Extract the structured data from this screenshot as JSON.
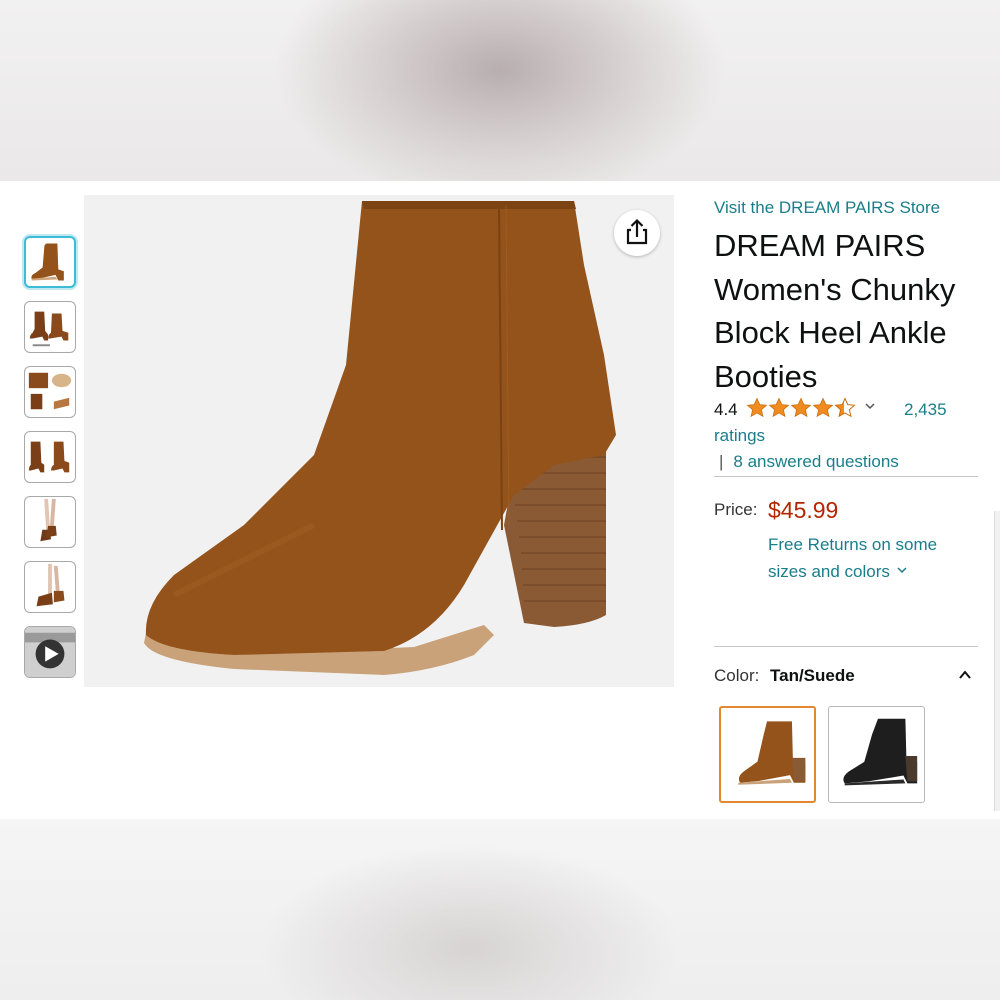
{
  "store": {
    "link_text": "Visit the DREAM PAIRS Store"
  },
  "product": {
    "title": "DREAM PAIRS Women's Chunky Block Heel Ankle Booties",
    "main_image_alt": "Tan suede ankle bootie"
  },
  "rating": {
    "value": "4.4",
    "stars": 4.4,
    "count": "2,435",
    "count_suffix": "ratings",
    "answered_questions": "8 answered questions",
    "separator": "|"
  },
  "price": {
    "label": "Price:",
    "value": "$45.99",
    "returns": "Free Returns on some sizes and colors"
  },
  "color": {
    "label": "Color:",
    "selected": "Tan/Suede",
    "options": [
      "Tan/Suede",
      "Black"
    ]
  },
  "colors": {
    "link": "#1a7d8a",
    "price": "#b12704",
    "star": "#f08c1f",
    "selected_thumb": "#3dbcd8",
    "selected_swatch": "#e3882f",
    "boot_tan": "#93531a",
    "heel_wood": "#8a5a35"
  },
  "thumbnails": [
    "boot-side",
    "boot-pair",
    "boot-sole",
    "boot-pair-front",
    "model-legs",
    "model-legs-side",
    "video-play-icon"
  ],
  "icons": [
    "share-icon",
    "star-rating-icon",
    "chevron-down-icon",
    "chevron-up-icon",
    "play-icon"
  ]
}
